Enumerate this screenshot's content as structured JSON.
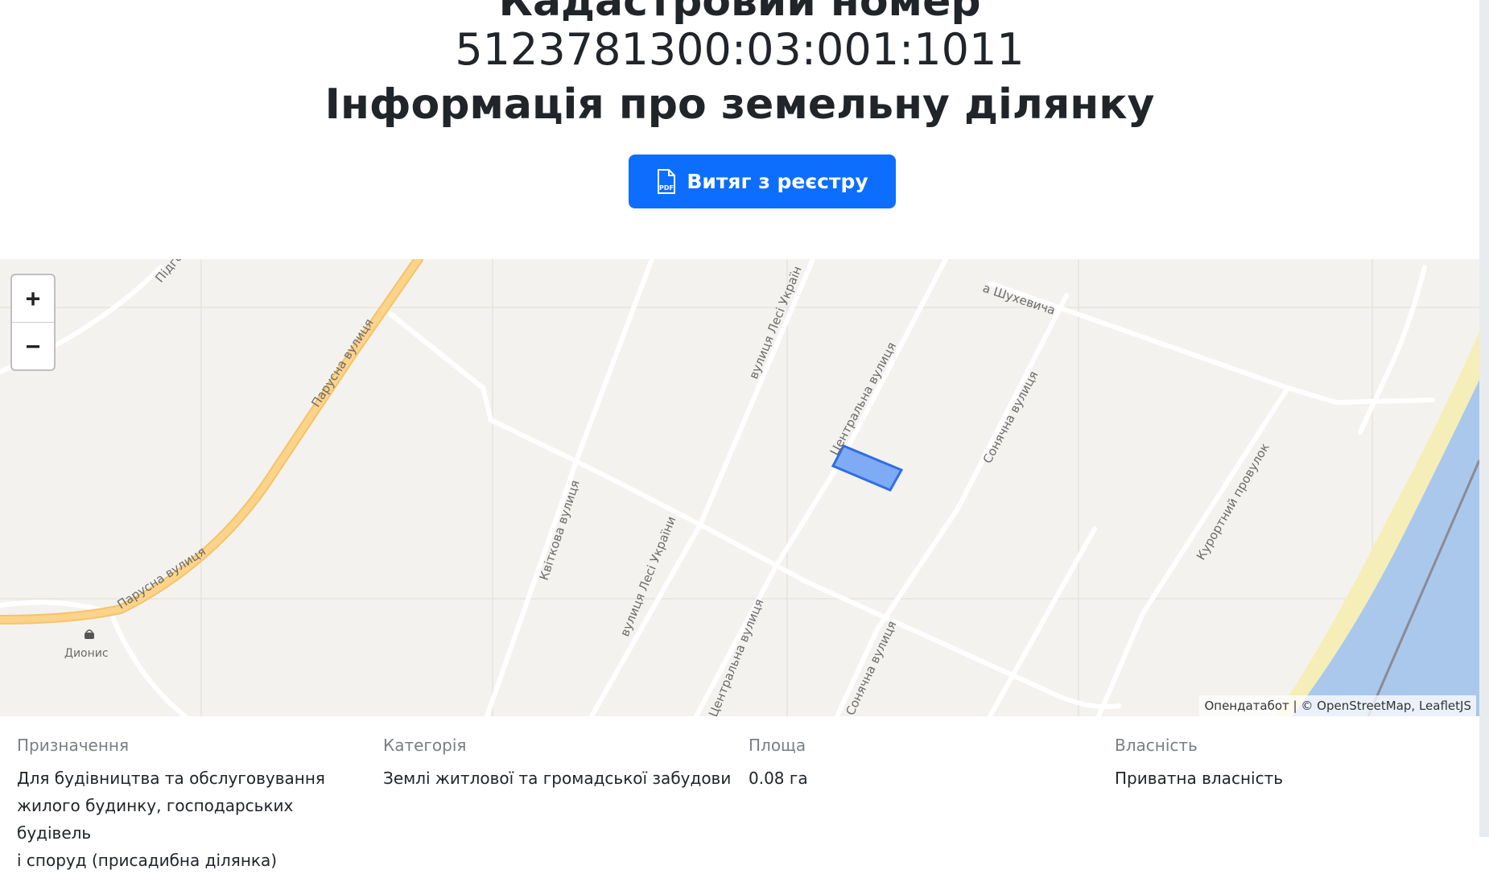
{
  "header": {
    "title_line1": "Кадастровий номер",
    "cadastral_number": "5123781300:03:001:1011",
    "title_line3": "Інформація про земельну ділянку",
    "extract_button_label": "Витяг з реєстру"
  },
  "map": {
    "zoom_in_label": "+",
    "zoom_out_label": "−",
    "attribution": "Опендатабот | © OpenStreetMap, LeafletJS",
    "street_labels": [
      "Підго",
      "Парусна вулиця",
      "Парусна вулиця",
      "вулиця Лесі Україн",
      "а Шухевича",
      "Центральна вулиця",
      "Сонячна вулиця",
      "Квіткова вулиця",
      "вулиця Лесі України",
      "Центральна вулиця",
      "Сонячна вулиця",
      "Курортний провулок"
    ],
    "poi_label": "Дионис",
    "colors": {
      "parcel_fill": "#6a9ef5",
      "parcel_stroke": "#2f6ee3",
      "water": "#aac8ec",
      "beach": "#f5eeb8",
      "main_road": "#fdd38a"
    }
  },
  "info": {
    "purpose_label": "Призначення",
    "purpose_line1": "Для будівництва та обслуговування",
    "purpose_line2": "жилого будинку, господарських будівель",
    "purpose_line3": "і споруд (присадибна ділянка)",
    "category_label": "Категорія",
    "category_value": "Землі житлової та громадської забудови",
    "area_label": "Площа",
    "area_value": "0.08 га",
    "ownership_label": "Власність",
    "ownership_value": "Приватна власність"
  }
}
